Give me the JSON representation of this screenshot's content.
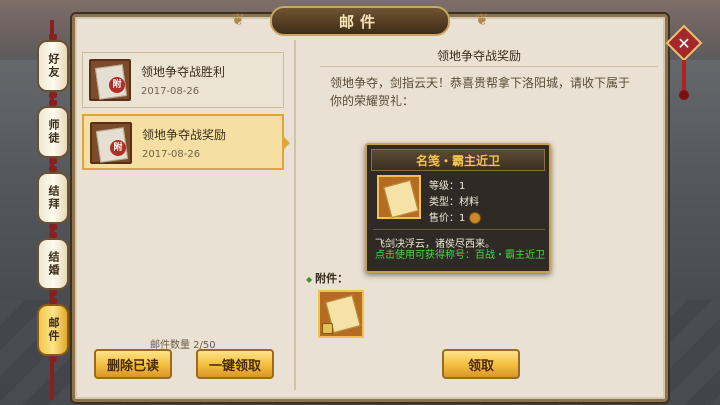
{
  "window": {
    "title": "邮件"
  },
  "tabs": [
    {
      "label": "好友"
    },
    {
      "label": "师徒"
    },
    {
      "label": "结拜"
    },
    {
      "label": "结婚"
    },
    {
      "label": "邮件",
      "active": true
    }
  ],
  "mail_list": {
    "items": [
      {
        "subject": "领地争夺战胜利",
        "date": "2017-08-26",
        "icon": "mail-scroll-icon",
        "selected": false
      },
      {
        "subject": "领地争夺战奖励",
        "date": "2017-08-26",
        "icon": "mail-scroll-icon",
        "selected": true
      }
    ],
    "count_label": "邮件数量 2/50",
    "delete_read_label": "删除已读",
    "claim_all_label": "一键领取"
  },
  "detail": {
    "title": "领地争夺战奖励",
    "body": "领地争夺，剑指云天！恭喜贵帮拿下洛阳城，请收下属于你的荣耀贺礼：",
    "attachment_label": "附件：",
    "claim_label": "领取"
  },
  "tooltip": {
    "name": "名笺・霸主近卫",
    "level_label": "等级：1",
    "type_label": "类型：材料",
    "price_label": "售价：1",
    "description": "飞剑决浮云，诸侯尽西来。",
    "effect": "点击使用可获得称号：百战・霸主近卫"
  },
  "colors": {
    "accent_gold": "#f0c34a",
    "effect_green": "#47d84a",
    "close_red": "#a3282a"
  }
}
